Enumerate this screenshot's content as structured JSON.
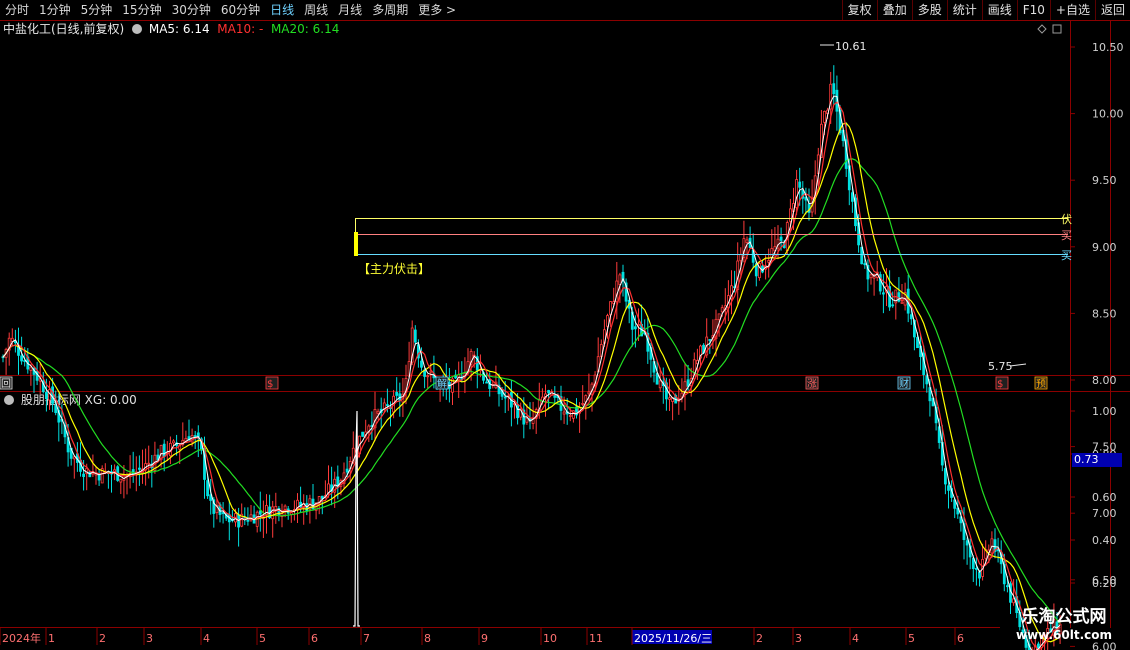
{
  "periods": [
    "分时",
    "1分钟",
    "5分钟",
    "15分钟",
    "30分钟",
    "60分钟",
    "日线",
    "周线",
    "月线",
    "多周期",
    "更多"
  ],
  "active_period": "日线",
  "more_arrow": ">",
  "toolbar": [
    "复权",
    "叠加",
    "多股",
    "统计",
    "画线",
    "F10",
    "+自选",
    "返回"
  ],
  "main": {
    "title": "中盐化工(日线,前复权)",
    "ma5": "MA5: 6.14",
    "ma10": "MA10: -",
    "ma20": "MA20: 6.14",
    "annotation": "【主力伏击】",
    "high_label": "10.61",
    "low_label": "5.75",
    "right_tags": [
      "伏",
      "买",
      "买"
    ],
    "price_axis": [
      "10.50",
      "10.00",
      "9.50",
      "9.00",
      "8.50",
      "8.00",
      "7.50",
      "7.00",
      "6.50",
      "6.00"
    ],
    "event_tags": [
      "回",
      "$",
      "解",
      "涨",
      "财",
      "$",
      "预"
    ]
  },
  "indicator": {
    "title": "股朋指标网",
    "xg": "XG: 0.00",
    "axis": [
      "1.00",
      "0.80",
      "0.60",
      "0.40",
      "0.20"
    ],
    "highlight_value": "0.73"
  },
  "date_axis": {
    "labels": [
      "2024年",
      "1",
      "2",
      "3",
      "4",
      "5",
      "6",
      "7",
      "8",
      "9",
      "10",
      "11",
      "2025/11/26/三",
      "2",
      "3",
      "4",
      "5",
      "6"
    ]
  },
  "watermark": {
    "line1": "乐淘公式网",
    "line2": "www.60lt.com"
  },
  "colors": {
    "up": "#ff3b3b",
    "down": "#00e0e0",
    "ma5": "#ffffff",
    "ma10": "#ff3030",
    "ma20": "#22dd22",
    "ma_yellow": "#ffff00",
    "axis": "#8b0000"
  }
}
